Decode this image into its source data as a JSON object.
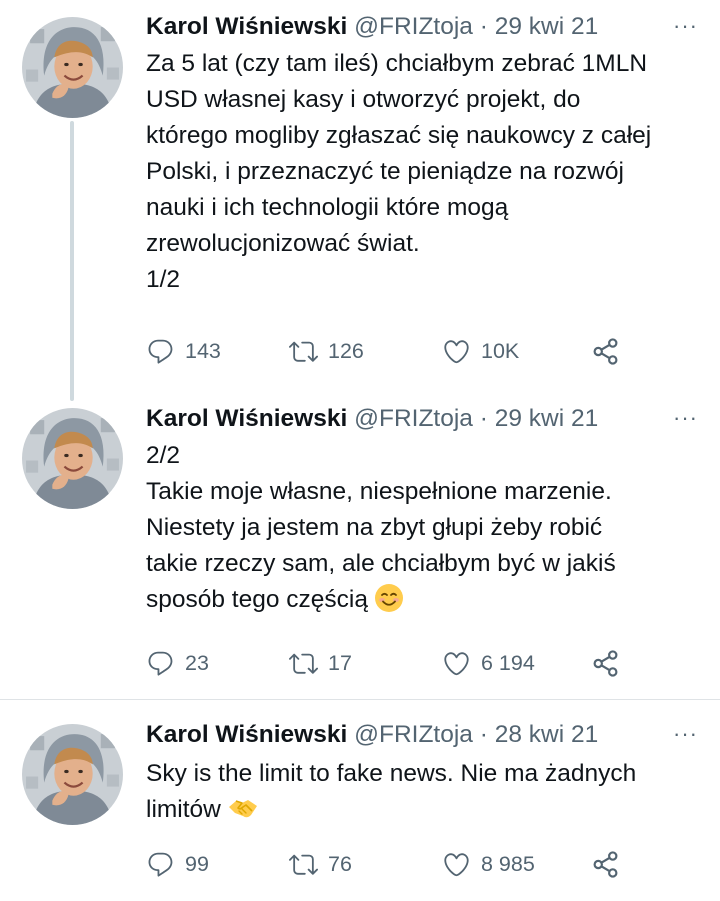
{
  "tweets": [
    {
      "name": "Karol Wiśniewski",
      "handle": "@FRIZtoja",
      "separator": "·",
      "date": "29 kwi 21",
      "lines": [
        "Za 5 lat (czy tam ileś) chciałbym zebrać 1MLN",
        "USD własnej kasy i otworzyć projekt, do",
        "którego mogliby zgłaszać się naukowcy z całej",
        "Polski, i przeznaczyć te pieniądze na rozwój",
        "nauki i ich technologii które mogą",
        "zrewolucjonizować świat.",
        "1/2"
      ],
      "replies": "143",
      "retweets": "126",
      "likes": "10K"
    },
    {
      "name": "Karol Wiśniewski",
      "handle": "@FRIZtoja",
      "separator": "·",
      "date": "29 kwi 21",
      "lines": [
        "2/2",
        "Takie moje własne, niespełnione marzenie.",
        "Niestety ja jestem na zbyt głupi żeby robić",
        "takie rzeczy sam, ale chciałbym być w jakiś",
        "sposób tego częścią"
      ],
      "emoji": "smiling-face-emoji",
      "replies": "23",
      "retweets": "17",
      "likes": "6 194"
    },
    {
      "name": "Karol Wiśniewski",
      "handle": "@FRIZtoja",
      "separator": "·",
      "date": "28 kwi 21",
      "lines": [
        "Sky is the limit to fake news. Nie ma żadnych",
        "limitów"
      ],
      "emoji": "handshake-emoji",
      "replies": "99",
      "retweets": "76",
      "likes": "8 985"
    }
  ],
  "icons": {
    "reply": "reply-icon",
    "retweet": "retweet-icon",
    "like": "heart-icon",
    "share": "share-icon",
    "more": "more-options-icon"
  },
  "colors": {
    "text": "#0f1419",
    "secondary": "#536471",
    "thread_line": "#cfd9de",
    "separator": "#dfe3e6"
  }
}
